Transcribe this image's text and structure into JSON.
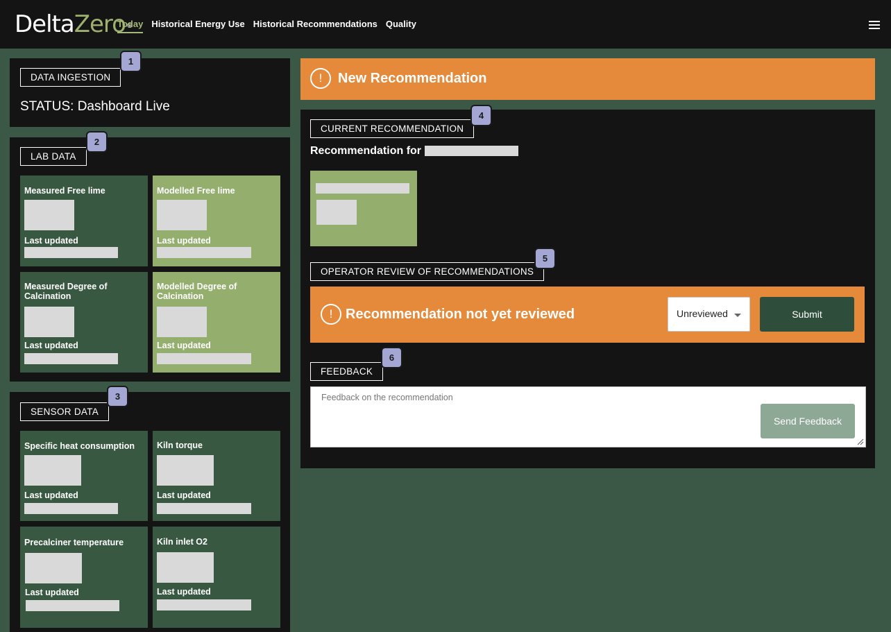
{
  "brand": {
    "delta": "Delta",
    "zero": "Zero",
    "reg": "®"
  },
  "nav": {
    "items": [
      {
        "label": "Today",
        "active": true
      },
      {
        "label": "Historical Energy Use",
        "active": false
      },
      {
        "label": "Historical Recommendations",
        "active": false
      },
      {
        "label": "Quality",
        "active": false
      }
    ],
    "menu_icon": "hamburger-icon"
  },
  "data_ingestion": {
    "label": "DATA INGESTION",
    "badge": "1",
    "status": "STATUS: Dashboard Live"
  },
  "lab_data": {
    "label": "LAB DATA",
    "badge": "2",
    "tiles": [
      {
        "title": "Measured Free lime",
        "updated": "Last updated"
      },
      {
        "title": "Modelled Free lime",
        "updated": "Last updated"
      },
      {
        "title": "Measured Degree of Calcination",
        "updated": "Last updated"
      },
      {
        "title": "Modelled Degree of Calcination",
        "updated": "Last updated"
      }
    ]
  },
  "sensor_data": {
    "label": "SENSOR DATA",
    "badge": "3",
    "tiles": [
      {
        "title": "Specific heat consumption",
        "updated": "Last updated"
      },
      {
        "title": "Kiln torque",
        "updated": "Last updated"
      },
      {
        "title": "Precalciner temperature",
        "updated": "Last updated"
      },
      {
        "title": "Kiln inlet O2",
        "updated": "Last updated"
      }
    ]
  },
  "new_recommendation": {
    "icon": "exclamation-icon",
    "icon_glyph": "!",
    "text": "New Recommendation"
  },
  "current_recommendation": {
    "label": "CURRENT RECOMMENDATION",
    "badge": "4",
    "for_text": "Recommendation for"
  },
  "operator_review": {
    "label": "OPERATOR REVIEW OF RECOMMENDATIONS",
    "badge": "5",
    "icon_glyph": "!",
    "status_text": "Recommendation not yet reviewed",
    "select_value": "Unreviewed",
    "submit_label": "Submit"
  },
  "feedback": {
    "label": "FEEDBACK",
    "badge": "6",
    "placeholder": "Feedback on the recommendation",
    "send_label": "Send Feedback"
  },
  "colors": {
    "page_bg": "#3a5845",
    "panel_bg": "#141414",
    "tile_dark": "#385842",
    "tile_light": "#93ae6d",
    "alert_orange": "#e5893a",
    "badge": "#a4a7d4",
    "accent": "#a4b87a"
  }
}
